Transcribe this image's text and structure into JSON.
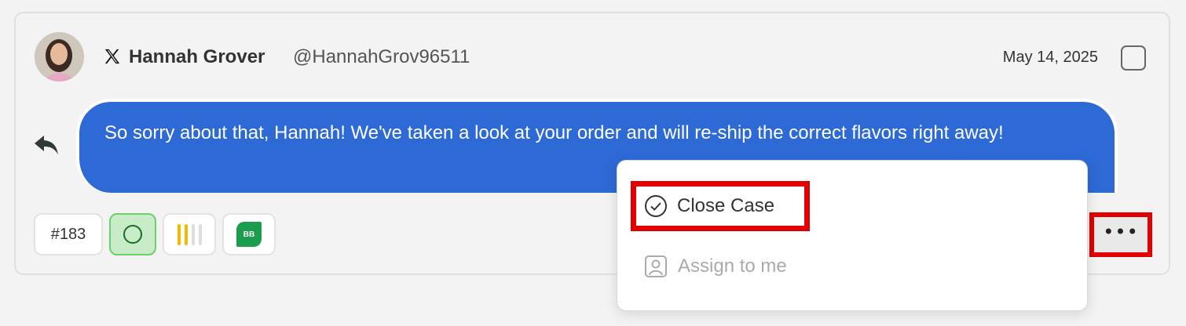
{
  "post": {
    "platform_icon": "x-logo-icon",
    "author_name": "Hannah Grover",
    "author_handle": "@HannahGrov96511",
    "date": "May 14, 2025",
    "message": "So sorry about that, Hannah! We've taken a look at your order and will re-ship the correct flavors right away!"
  },
  "tags": {
    "case_number": "#183",
    "brand_initials": "BB"
  },
  "colors": {
    "bubble": "#2d6ad6",
    "highlight": "#e00000",
    "status_green": "#c7ecc7",
    "priority_yellow": "#f5b800",
    "brand_green": "#1a9d4c"
  },
  "menu": {
    "close_case_label": "Close Case",
    "assign_label": "Assign to me"
  },
  "more_button": {
    "label": "•••"
  }
}
